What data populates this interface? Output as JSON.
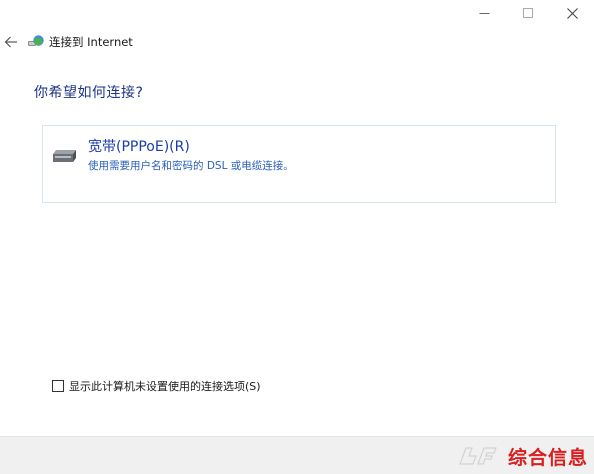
{
  "window": {
    "controls": {
      "minimize_icon": "minimize-icon",
      "maximize_icon": "maximize-icon",
      "close_icon": "close-icon"
    }
  },
  "navbar": {
    "back_icon": "back-arrow-icon",
    "app_icon": "network-globe-icon",
    "title": "连接到 Internet"
  },
  "main": {
    "heading": "你希望如何连接?",
    "options": [
      {
        "icon": "broadband-modem-icon",
        "title": "宽带(PPPoE)(R)",
        "description": "使用需要用户名和密码的 DSL 或电缆连接。"
      }
    ]
  },
  "footer": {
    "checkbox_label": "显示此计算机未设置使用的连接选项(S)",
    "checkbox_checked": false
  },
  "watermark": {
    "text": "综合信息"
  },
  "colors": {
    "heading": "#1e3287",
    "option_title": "#1c3ca8",
    "option_border": "#d7e4f2",
    "bottom_bar": "#f0f0f0",
    "watermark": "#d81e1e"
  }
}
